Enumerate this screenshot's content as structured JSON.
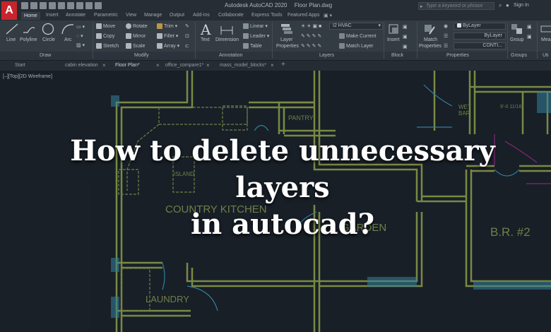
{
  "app": {
    "logo_letter": "A",
    "title": "Autodesk AutoCAD 2020",
    "file": "Floor Plan.dwg",
    "search_placeholder": "Type a keyword or phrase",
    "sign_in": "Sign In"
  },
  "ribbon_tabs": [
    "Home",
    "Insert",
    "Annotate",
    "Parametric",
    "View",
    "Manage",
    "Output",
    "Add-ins",
    "Collaborate",
    "Express Tools",
    "Featured Apps"
  ],
  "ribbon": {
    "draw": {
      "title": "Draw",
      "line": "Line",
      "polyline": "Polyline",
      "circle": "Circle",
      "arc": "Arc"
    },
    "modify": {
      "title": "Modify",
      "move": "Move",
      "rotate": "Rotate",
      "trim": "Trim",
      "copy": "Copy",
      "mirror": "Mirror",
      "fillet": "Fillet",
      "stretch": "Stretch",
      "scale": "Scale",
      "array": "Array"
    },
    "annotation": {
      "title": "Annotation",
      "text": "Text",
      "dimension": "Dimension",
      "linear": "Linear",
      "leader": "Leader",
      "table": "Table"
    },
    "layers": {
      "title": "Layers",
      "layer_properties": "Layer",
      "layer_properties_2": "Properties",
      "current_layer": "I2 HVAC",
      "make_current": "Make Current",
      "match_layer": "Match Layer"
    },
    "block": {
      "title": "Block",
      "insert": "Insert"
    },
    "properties": {
      "title": "Properties",
      "match": "Match",
      "match_2": "Properties",
      "color": "ByLayer",
      "linetype": "ByLayer",
      "lineweight": "CONTI..."
    },
    "groups": {
      "title": "Groups",
      "group": "Group"
    },
    "utilities": {
      "title": "Uti",
      "measure": "Mea"
    }
  },
  "file_tabs": [
    {
      "label": "Start",
      "active": false
    },
    {
      "label": "cabin elevation",
      "active": false
    },
    {
      "label": "Floor Plan*",
      "active": true
    },
    {
      "label": "office_compare1*",
      "active": false
    },
    {
      "label": "mass_model_blocks*",
      "active": false
    }
  ],
  "viewport_label": "[–][Top][2D Wireframe]",
  "drawing_labels": {
    "pantry": "PANTRY",
    "island": "ISLAND",
    "country_kitchen": "COUNTRY KITCHEN",
    "garden": "GARDEN",
    "laundry": "LAUNDRY",
    "bedroom": "B.R. #2",
    "wet_bar_1": "WET",
    "wet_bar_2": "BAR",
    "dimension": "9'-0 11/16\""
  },
  "headline": {
    "line1": "How to delete unnecessary layers",
    "line2": "in autocad?"
  },
  "colors": {
    "wall": "#8a9a4a",
    "wall_fill": "#4a5a2a",
    "label": "#7f8f4f",
    "cyan": "#3a8fb0",
    "magenta": "#9a2a8a",
    "background": "#1b222b"
  }
}
